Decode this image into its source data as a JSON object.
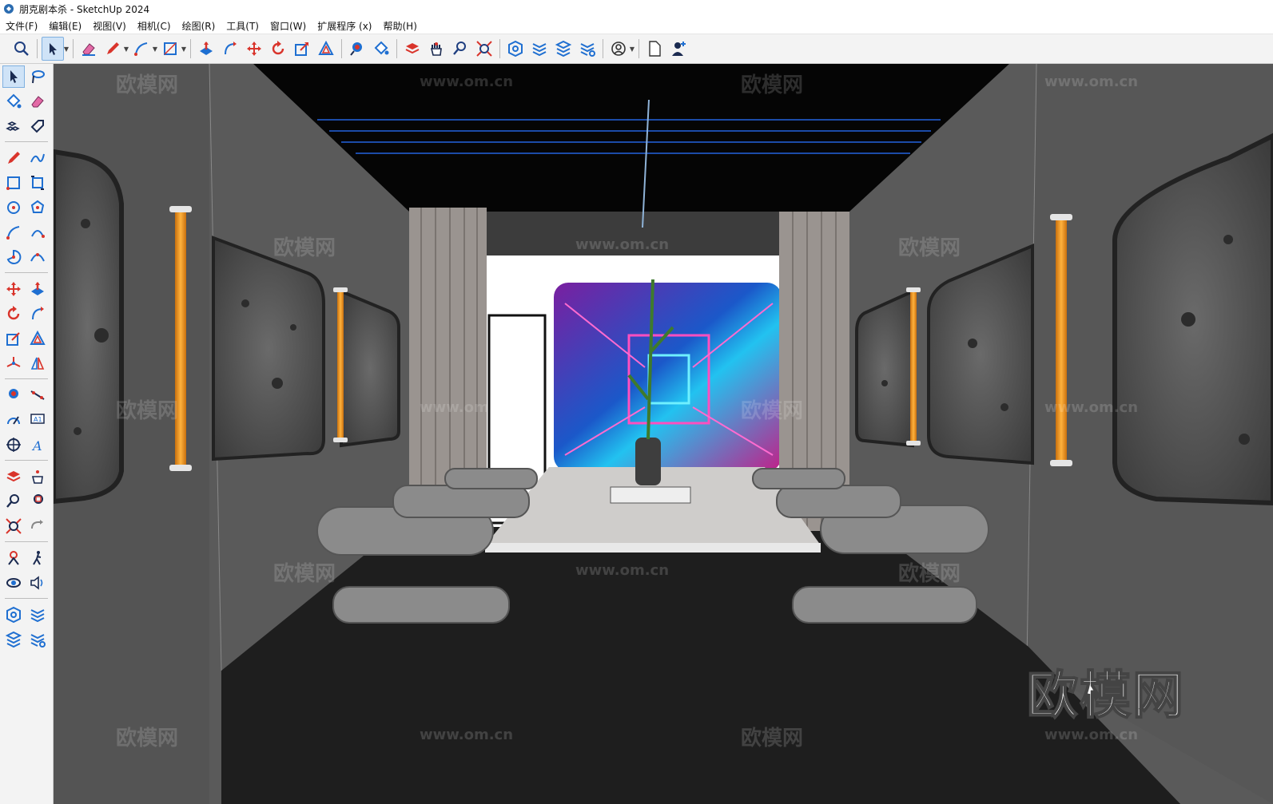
{
  "window": {
    "title": "朋克剧本杀 - SketchUp 2024"
  },
  "menu": [
    "文件(F)",
    "编辑(E)",
    "视图(V)",
    "相机(C)",
    "绘图(R)",
    "工具(T)",
    "窗口(W)",
    "扩展程序 (x)",
    "帮助(H)"
  ],
  "toolbar": {
    "icons": [
      "search-icon",
      "select-icon",
      "eraser-icon",
      "pencil-icon",
      "arc-icon",
      "rectangle-icon",
      "push-pull-icon",
      "follow-me-icon",
      "move-icon",
      "rotate-icon",
      "scale-icon",
      "offset-icon",
      "tape-measure-icon",
      "paint-bucket-icon",
      "section-plane-icon",
      "hand-icon",
      "zoom-icon",
      "zoom-extents-icon",
      "warehouse-icon",
      "layers-icon",
      "tags-icon",
      "components-icon",
      "account-icon",
      "new-file-icon",
      "user-add-icon"
    ]
  },
  "left_toolbar": {
    "icons": [
      "select-icon",
      "lasso-icon",
      "paint-icon",
      "eraser-icon",
      "component-icon",
      "tag-icon",
      "pencil-icon",
      "freehand-icon",
      "rectangle-icon",
      "rotated-rect-icon",
      "circle-icon",
      "polygon-icon",
      "arc-icon",
      "arc-2pt-icon",
      "pie-icon",
      "arc-3pt-icon",
      "move-icon",
      "push-pull-icon",
      "rotate-icon",
      "follow-me-icon",
      "scale-icon",
      "offset-icon",
      "axes-icon",
      "mirror-icon",
      "tape-icon",
      "dimension-icon",
      "protractor-icon",
      "text-icon",
      "crosshair-icon",
      "3d-text-icon",
      "section-icon",
      "hand-icon",
      "zoom-icon",
      "zoom-window-icon",
      "zoom-extents-icon",
      "previous-view-icon",
      "position-camera-icon",
      "walk-icon",
      "look-around-icon",
      "sound-icon",
      "warehouse-icon",
      "layers-icon",
      "stack-icon",
      "settings-icon"
    ]
  },
  "viewport": {
    "watermark_text": "欧模网",
    "watermark_url": "www.om.cn",
    "logo_text": "欧模网"
  },
  "colors": {
    "accent": "#1f6fd1",
    "orange_tube": "#f39a1e",
    "wall": "#555555",
    "floor": "#1f1f1f",
    "ceiling": "#050505"
  }
}
